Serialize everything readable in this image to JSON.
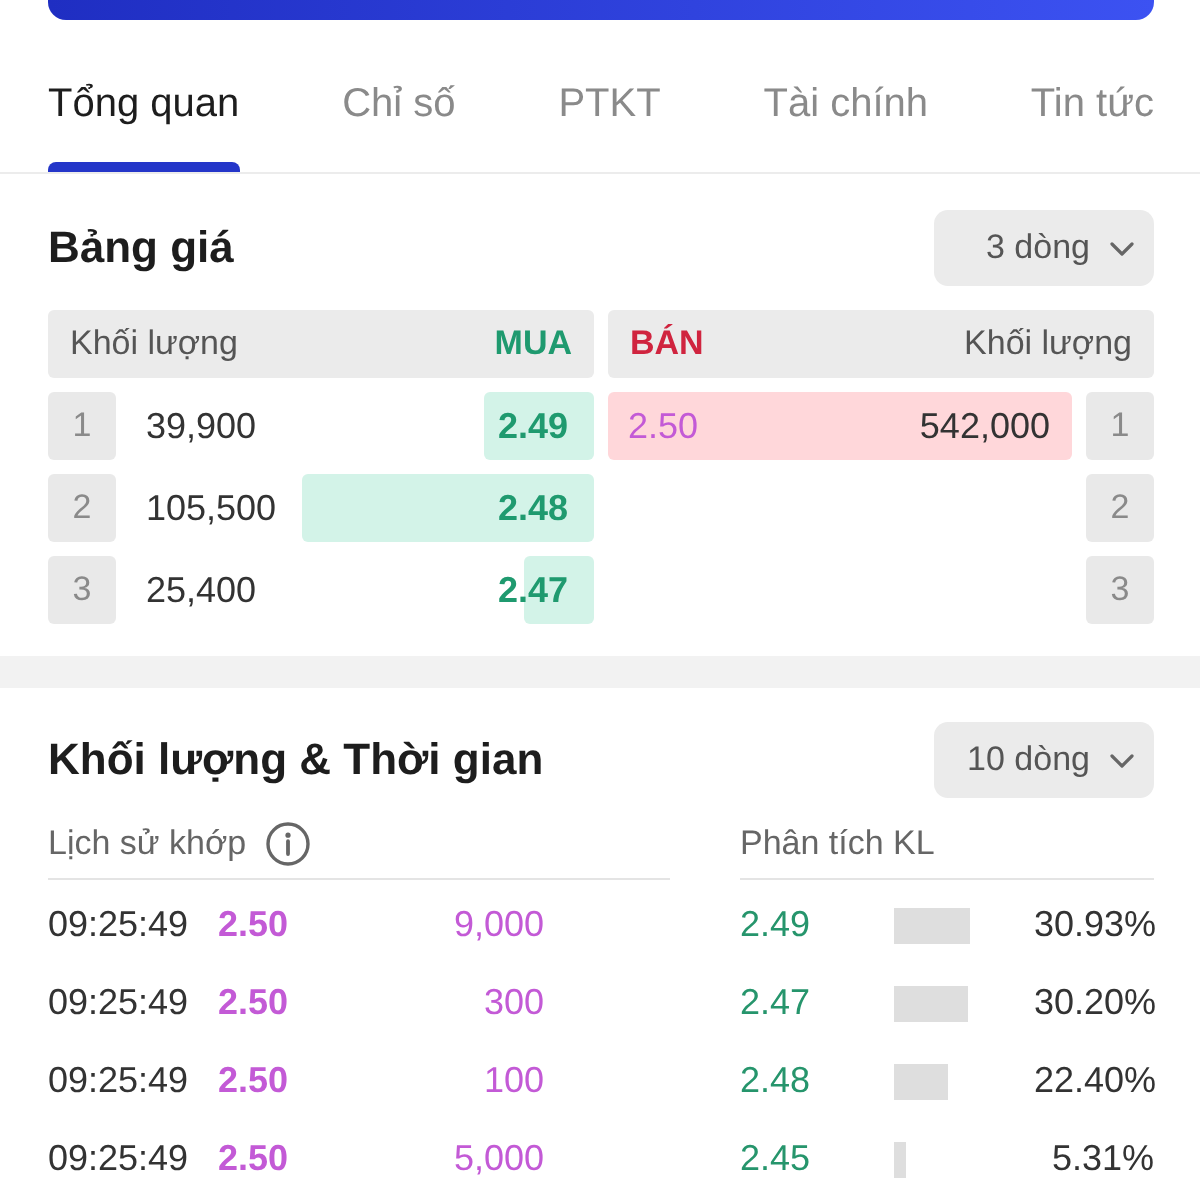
{
  "tabs": [
    {
      "label": "Tổng quan",
      "selected": true
    },
    {
      "label": "Chỉ số",
      "selected": false
    },
    {
      "label": "PTKT",
      "selected": false
    },
    {
      "label": "Tài chính",
      "selected": false
    },
    {
      "label": "Tin tức",
      "selected": false
    }
  ],
  "price_board": {
    "title": "Bảng giá",
    "rows_dropdown": "3 dòng",
    "columns": {
      "bid_volume": "Khối lượng",
      "bid": "MUA",
      "ask": "BÁN",
      "ask_volume": "Khối lượng"
    },
    "rows": [
      {
        "bid": {
          "index": "1",
          "volume": "39,900",
          "price": "2.49",
          "level": 0.24
        },
        "ask": {
          "index": "1",
          "price": "2.50",
          "volume": "542,000",
          "level": 1
        }
      },
      {
        "bid": {
          "index": "2",
          "volume": "105,500",
          "price": "2.48",
          "level": 0.63
        },
        "ask": {
          "index": "2"
        }
      },
      {
        "bid": {
          "index": "3",
          "volume": "25,400",
          "price": "2.47",
          "level": 0.15
        },
        "ask": {
          "index": "3"
        }
      }
    ]
  },
  "volume_time": {
    "title": "Khối lượng & Thời gian",
    "rows_dropdown": "10 dòng",
    "match_history": {
      "heading": "Lịch sử khớp",
      "rows": [
        {
          "time": "09:25:49",
          "price": "2.50",
          "volume": "9,000"
        },
        {
          "time": "09:25:49",
          "price": "2.50",
          "volume": "300"
        },
        {
          "time": "09:25:49",
          "price": "2.50",
          "volume": "100"
        },
        {
          "time": "09:25:49",
          "price": "2.50",
          "volume": "5,000"
        }
      ]
    },
    "volume_analysis": {
      "heading": "Phân tích KL",
      "rows": [
        {
          "price": "2.49",
          "level": 0.54,
          "share": "30.93%"
        },
        {
          "price": "2.47",
          "level": 0.53,
          "share": "30.20%"
        },
        {
          "price": "2.48",
          "level": 0.39,
          "share": "22.40%"
        },
        {
          "price": "2.45",
          "level": 0.09,
          "share": "5.31%"
        }
      ]
    }
  }
}
